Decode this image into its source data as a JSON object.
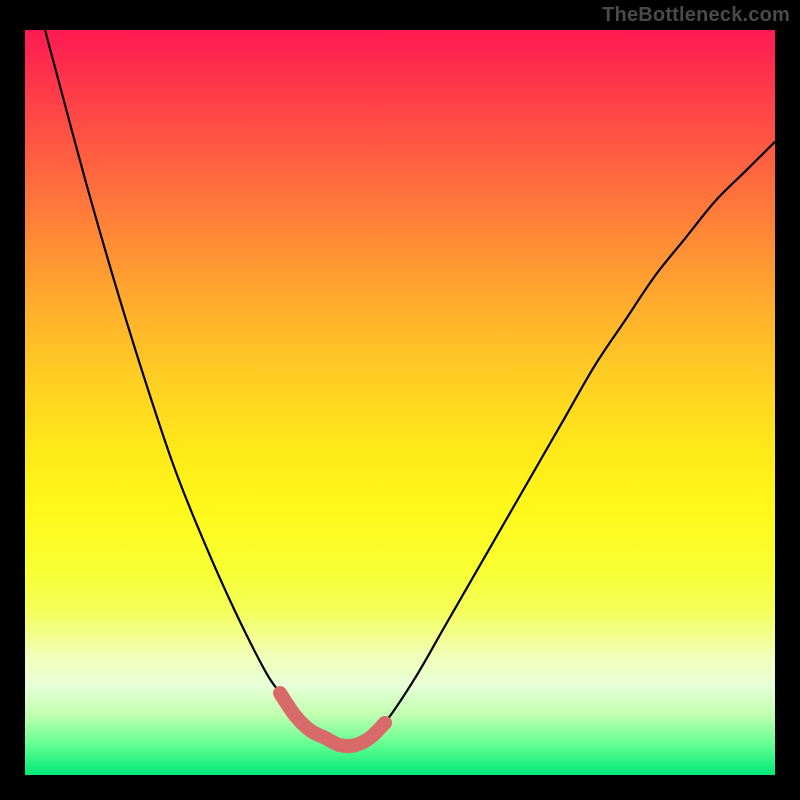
{
  "attribution": "TheBottleneck.com",
  "colors": {
    "frame": "#000000",
    "curve": "#000000",
    "trough_highlight": "#d86a6a",
    "gradient_top": "#ff1a52",
    "gradient_bottom": "#00e878"
  },
  "chart_data": {
    "type": "line",
    "title": "",
    "xlabel": "",
    "ylabel": "",
    "xlim": [
      0,
      100
    ],
    "ylim": [
      0,
      100
    ],
    "x": [
      0,
      4,
      8,
      12,
      16,
      20,
      24,
      28,
      32,
      34,
      36,
      38,
      40,
      42,
      44,
      46,
      48,
      52,
      56,
      60,
      64,
      68,
      72,
      76,
      80,
      84,
      88,
      92,
      96,
      100
    ],
    "values": [
      110,
      95,
      80,
      66,
      53,
      41,
      31,
      22,
      14,
      11,
      8,
      6,
      5,
      4,
      4,
      5,
      7,
      13,
      20,
      27,
      34,
      41,
      48,
      55,
      61,
      67,
      72,
      77,
      81,
      85
    ],
    "series": [
      {
        "name": "bottleneck-curve",
        "x": [
          0,
          4,
          8,
          12,
          16,
          20,
          24,
          28,
          32,
          34,
          36,
          38,
          40,
          42,
          44,
          46,
          48,
          52,
          56,
          60,
          64,
          68,
          72,
          76,
          80,
          84,
          88,
          92,
          96,
          100
        ],
        "values": [
          110,
          95,
          80,
          66,
          53,
          41,
          31,
          22,
          14,
          11,
          8,
          6,
          5,
          4,
          4,
          5,
          7,
          13,
          20,
          27,
          34,
          41,
          48,
          55,
          61,
          67,
          72,
          77,
          81,
          85
        ]
      },
      {
        "name": "trough-highlight",
        "x": [
          34,
          36,
          38,
          40,
          42,
          44,
          46,
          48
        ],
        "values": [
          11,
          8,
          6,
          5,
          4,
          4,
          5,
          7
        ]
      }
    ],
    "annotations": []
  }
}
